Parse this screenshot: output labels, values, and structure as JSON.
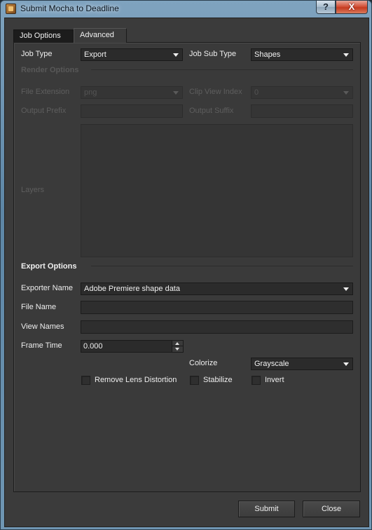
{
  "window": {
    "title": "Submit Mocha to Deadline",
    "help_label": "?",
    "close_label": "X"
  },
  "tabs": [
    {
      "label": "Job Options"
    },
    {
      "label": "Advanced"
    }
  ],
  "job": {
    "job_type_label": "Job Type",
    "job_type_value": "Export",
    "job_sub_type_label": "Job Sub Type",
    "job_sub_type_value": "Shapes"
  },
  "render_options": {
    "heading": "Render Options",
    "file_extension_label": "File Extension",
    "file_extension_value": "png",
    "clip_view_index_label": "Clip View Index",
    "clip_view_index_value": "0",
    "output_prefix_label": "Output Prefix",
    "output_prefix_value": "",
    "output_suffix_label": "Output Suffix",
    "output_suffix_value": "",
    "layers_label": "Layers"
  },
  "export_options": {
    "heading": "Export Options",
    "exporter_name_label": "Exporter Name",
    "exporter_name_value": "Adobe Premiere shape data",
    "file_name_label": "File Name",
    "file_name_value": "",
    "view_names_label": "View Names",
    "view_names_value": "",
    "frame_time_label": "Frame Time",
    "frame_time_value": "0.000",
    "colorize_label": "Colorize",
    "colorize_value": "Grayscale",
    "remove_lens_distortion_label": "Remove Lens Distortion",
    "stabilize_label": "Stabilize",
    "invert_label": "Invert"
  },
  "footer": {
    "submit_label": "Submit",
    "close_label": "Close"
  }
}
